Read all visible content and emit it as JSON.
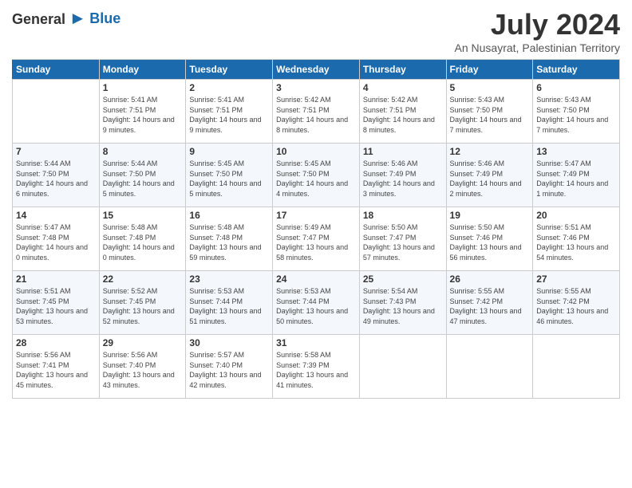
{
  "header": {
    "logo_general": "General",
    "logo_blue": "Blue",
    "month_year": "July 2024",
    "location": "An Nusayrat, Palestinian Territory"
  },
  "weekdays": [
    "Sunday",
    "Monday",
    "Tuesday",
    "Wednesday",
    "Thursday",
    "Friday",
    "Saturday"
  ],
  "weeks": [
    [
      {
        "day": "",
        "sunrise": "",
        "sunset": "",
        "daylight": ""
      },
      {
        "day": "1",
        "sunrise": "Sunrise: 5:41 AM",
        "sunset": "Sunset: 7:51 PM",
        "daylight": "Daylight: 14 hours and 9 minutes."
      },
      {
        "day": "2",
        "sunrise": "Sunrise: 5:41 AM",
        "sunset": "Sunset: 7:51 PM",
        "daylight": "Daylight: 14 hours and 9 minutes."
      },
      {
        "day": "3",
        "sunrise": "Sunrise: 5:42 AM",
        "sunset": "Sunset: 7:51 PM",
        "daylight": "Daylight: 14 hours and 8 minutes."
      },
      {
        "day": "4",
        "sunrise": "Sunrise: 5:42 AM",
        "sunset": "Sunset: 7:51 PM",
        "daylight": "Daylight: 14 hours and 8 minutes."
      },
      {
        "day": "5",
        "sunrise": "Sunrise: 5:43 AM",
        "sunset": "Sunset: 7:50 PM",
        "daylight": "Daylight: 14 hours and 7 minutes."
      },
      {
        "day": "6",
        "sunrise": "Sunrise: 5:43 AM",
        "sunset": "Sunset: 7:50 PM",
        "daylight": "Daylight: 14 hours and 7 minutes."
      }
    ],
    [
      {
        "day": "7",
        "sunrise": "Sunrise: 5:44 AM",
        "sunset": "Sunset: 7:50 PM",
        "daylight": "Daylight: 14 hours and 6 minutes."
      },
      {
        "day": "8",
        "sunrise": "Sunrise: 5:44 AM",
        "sunset": "Sunset: 7:50 PM",
        "daylight": "Daylight: 14 hours and 5 minutes."
      },
      {
        "day": "9",
        "sunrise": "Sunrise: 5:45 AM",
        "sunset": "Sunset: 7:50 PM",
        "daylight": "Daylight: 14 hours and 5 minutes."
      },
      {
        "day": "10",
        "sunrise": "Sunrise: 5:45 AM",
        "sunset": "Sunset: 7:50 PM",
        "daylight": "Daylight: 14 hours and 4 minutes."
      },
      {
        "day": "11",
        "sunrise": "Sunrise: 5:46 AM",
        "sunset": "Sunset: 7:49 PM",
        "daylight": "Daylight: 14 hours and 3 minutes."
      },
      {
        "day": "12",
        "sunrise": "Sunrise: 5:46 AM",
        "sunset": "Sunset: 7:49 PM",
        "daylight": "Daylight: 14 hours and 2 minutes."
      },
      {
        "day": "13",
        "sunrise": "Sunrise: 5:47 AM",
        "sunset": "Sunset: 7:49 PM",
        "daylight": "Daylight: 14 hours and 1 minute."
      }
    ],
    [
      {
        "day": "14",
        "sunrise": "Sunrise: 5:47 AM",
        "sunset": "Sunset: 7:48 PM",
        "daylight": "Daylight: 14 hours and 0 minutes."
      },
      {
        "day": "15",
        "sunrise": "Sunrise: 5:48 AM",
        "sunset": "Sunset: 7:48 PM",
        "daylight": "Daylight: 14 hours and 0 minutes."
      },
      {
        "day": "16",
        "sunrise": "Sunrise: 5:48 AM",
        "sunset": "Sunset: 7:48 PM",
        "daylight": "Daylight: 13 hours and 59 minutes."
      },
      {
        "day": "17",
        "sunrise": "Sunrise: 5:49 AM",
        "sunset": "Sunset: 7:47 PM",
        "daylight": "Daylight: 13 hours and 58 minutes."
      },
      {
        "day": "18",
        "sunrise": "Sunrise: 5:50 AM",
        "sunset": "Sunset: 7:47 PM",
        "daylight": "Daylight: 13 hours and 57 minutes."
      },
      {
        "day": "19",
        "sunrise": "Sunrise: 5:50 AM",
        "sunset": "Sunset: 7:46 PM",
        "daylight": "Daylight: 13 hours and 56 minutes."
      },
      {
        "day": "20",
        "sunrise": "Sunrise: 5:51 AM",
        "sunset": "Sunset: 7:46 PM",
        "daylight": "Daylight: 13 hours and 54 minutes."
      }
    ],
    [
      {
        "day": "21",
        "sunrise": "Sunrise: 5:51 AM",
        "sunset": "Sunset: 7:45 PM",
        "daylight": "Daylight: 13 hours and 53 minutes."
      },
      {
        "day": "22",
        "sunrise": "Sunrise: 5:52 AM",
        "sunset": "Sunset: 7:45 PM",
        "daylight": "Daylight: 13 hours and 52 minutes."
      },
      {
        "day": "23",
        "sunrise": "Sunrise: 5:53 AM",
        "sunset": "Sunset: 7:44 PM",
        "daylight": "Daylight: 13 hours and 51 minutes."
      },
      {
        "day": "24",
        "sunrise": "Sunrise: 5:53 AM",
        "sunset": "Sunset: 7:44 PM",
        "daylight": "Daylight: 13 hours and 50 minutes."
      },
      {
        "day": "25",
        "sunrise": "Sunrise: 5:54 AM",
        "sunset": "Sunset: 7:43 PM",
        "daylight": "Daylight: 13 hours and 49 minutes."
      },
      {
        "day": "26",
        "sunrise": "Sunrise: 5:55 AM",
        "sunset": "Sunset: 7:42 PM",
        "daylight": "Daylight: 13 hours and 47 minutes."
      },
      {
        "day": "27",
        "sunrise": "Sunrise: 5:55 AM",
        "sunset": "Sunset: 7:42 PM",
        "daylight": "Daylight: 13 hours and 46 minutes."
      }
    ],
    [
      {
        "day": "28",
        "sunrise": "Sunrise: 5:56 AM",
        "sunset": "Sunset: 7:41 PM",
        "daylight": "Daylight: 13 hours and 45 minutes."
      },
      {
        "day": "29",
        "sunrise": "Sunrise: 5:56 AM",
        "sunset": "Sunset: 7:40 PM",
        "daylight": "Daylight: 13 hours and 43 minutes."
      },
      {
        "day": "30",
        "sunrise": "Sunrise: 5:57 AM",
        "sunset": "Sunset: 7:40 PM",
        "daylight": "Daylight: 13 hours and 42 minutes."
      },
      {
        "day": "31",
        "sunrise": "Sunrise: 5:58 AM",
        "sunset": "Sunset: 7:39 PM",
        "daylight": "Daylight: 13 hours and 41 minutes."
      },
      {
        "day": "",
        "sunrise": "",
        "sunset": "",
        "daylight": ""
      },
      {
        "day": "",
        "sunrise": "",
        "sunset": "",
        "daylight": ""
      },
      {
        "day": "",
        "sunrise": "",
        "sunset": "",
        "daylight": ""
      }
    ]
  ]
}
